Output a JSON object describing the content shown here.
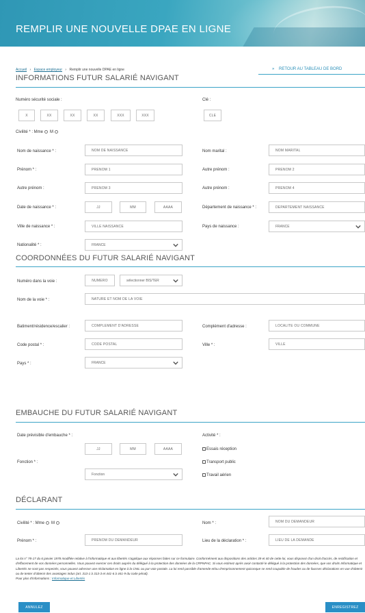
{
  "header": {
    "title": "REMPLIR UNE NOUVELLE DPAE EN LIGNE"
  },
  "breadcrumb": {
    "home": "Accueil",
    "space": "Espace employeur",
    "current": "Remplir une nouvelle DPAE en ligne",
    "separator": "›"
  },
  "back_link": {
    "label": "RETOUR AU TABLEAU DE BORD",
    "chevron": "»"
  },
  "employee_info": {
    "title": "INFORMATIONS FUTUR SALARIÉ NAVIGANT",
    "ssn_label": "Numéro sécurité sociale :",
    "ssn_fields": [
      "X",
      "XX",
      "XX",
      "XX",
      "XXX",
      "XXX"
    ],
    "key_label": "Clé :",
    "key_placeholder": "CLE",
    "civility_label": "Civilité * : Mme",
    "civility_m": "M",
    "birth_name_label": "Nom de naissance * :",
    "birth_name_placeholder": "NOM DE NAISSANCE",
    "married_name_label": "Nom marital :",
    "married_name_placeholder": "NOM MARITAL",
    "first_name_label": "Prénom * :",
    "first_name_placeholder": "PRENOM 1",
    "other_first_name_label": "Autre prénom :",
    "first_name_2_placeholder": "PRENOM 2",
    "other_first_name_3_label": "Autre prénom :",
    "first_name_3_placeholder": "PRENOM 3",
    "other_first_name_4_label": "Autre prénom :",
    "first_name_4_placeholder": "PRENOM 4",
    "birth_date_label": "Date de naissance * :",
    "birth_day_placeholder": "JJ",
    "birth_month_placeholder": "MM",
    "birth_year_placeholder": "AAAA",
    "birth_dept_label": "Département de naissance * :",
    "birth_dept_placeholder": "DEPARTEMENT NAISSANCE",
    "birth_city_label": "Ville de naissance * :",
    "birth_city_placeholder": "VILLE NAISSANCE",
    "birth_country_label": "Pays de naissance :",
    "birth_country_value": "FRANCE",
    "nationality_label": "Nationalité * :",
    "nationality_value": "FRANCE"
  },
  "address": {
    "title": "COORDONNÉES DU FUTUR SALARIÉ NAVIGANT",
    "street_number_label": "Numéro dans la voie :",
    "street_number_placeholder": "NUMERO",
    "bis_ter_value": "sélectionner BIS/TER",
    "street_name_label": "Nom de la voie * :",
    "street_name_placeholder": "NATURE ET NOM DE LA VOIE",
    "building_label": "Batiment/résidence/escalier :",
    "building_placeholder": "COMPLEMENT D'ADRESSE",
    "complement_label": "Complément d'adresse :",
    "complement_placeholder": "LOCALITE OU COMMUNE",
    "postal_label": "Code postal * :",
    "postal_placeholder": "CODE POSTAL",
    "city_label": "Ville * :",
    "city_placeholder": "VILLE",
    "country_label": "Pays * :",
    "country_value": "FRANCE"
  },
  "hiring": {
    "title": "EMBAUCHE DU FUTUR SALARIÉ NAVIGANT",
    "date_label": "Date prévisible d'embauche * :",
    "day_placeholder": "JJ",
    "month_placeholder": "MM",
    "year_placeholder": "AAAA",
    "function_label": "Fonction * :",
    "function_value": "Fonction",
    "activity_label": "Activité * :",
    "activities": [
      "Essais réception",
      "Transport public",
      "Travail aérien"
    ]
  },
  "declarant": {
    "title": "DÉCLARANT",
    "civility_label": "Civilité * : Mme",
    "civility_m": "M",
    "name_label": "Nom * :",
    "name_placeholder": "NOM DU DEMANDEUR",
    "first_name_label": "Prénom * :",
    "first_name_placeholder": "PRENOM DU DEMANDEUR",
    "place_label": "Lieu de la déclaration * :",
    "place_placeholder": "LIEU DE LA DEMANDE"
  },
  "legal": {
    "text": "La loi n° 78-17 du 6 janvier 1978 modifiée relative à l'informatique et aux libertés s'applique aux réponses faites sur ce formulaire. Conformément aux dispositions des articles 39 et 40 de cette loi, vous disposez d'un droit d'accès, de rectification et d'effacement de vos données personnelles. Vous pouvez exercer ces droits auprès du délégué à la protection des données de la CRPNPAC. Si vous estimez après avoir contacté le délégué à la protection des données, que vos droits Informatique et Libertés ne sont pas respectés, vous pouvez adresser une réclamation en ligne à la CNIL ou par voie postale. La loi rend passible d'amende et/ou d'emprisonnement quiconque se rend coupable de fraudes ou de fausses déclarations en vue d'obtenir ou de tenter d'obtenir des avantages indus (art. 313-1 à 313-3 et 441-6 à 441-9 du code pénal).",
    "more_prefix": "Pour plus d'informations :",
    "more_link": "Informatique et Libertés"
  },
  "actions": {
    "cancel": "ANNULEZ",
    "save": "ENREGISTREZ"
  },
  "colors": {
    "accent": "#2a8fc6",
    "rule": "#3aa3c6",
    "banner": "#3aa6c0"
  }
}
